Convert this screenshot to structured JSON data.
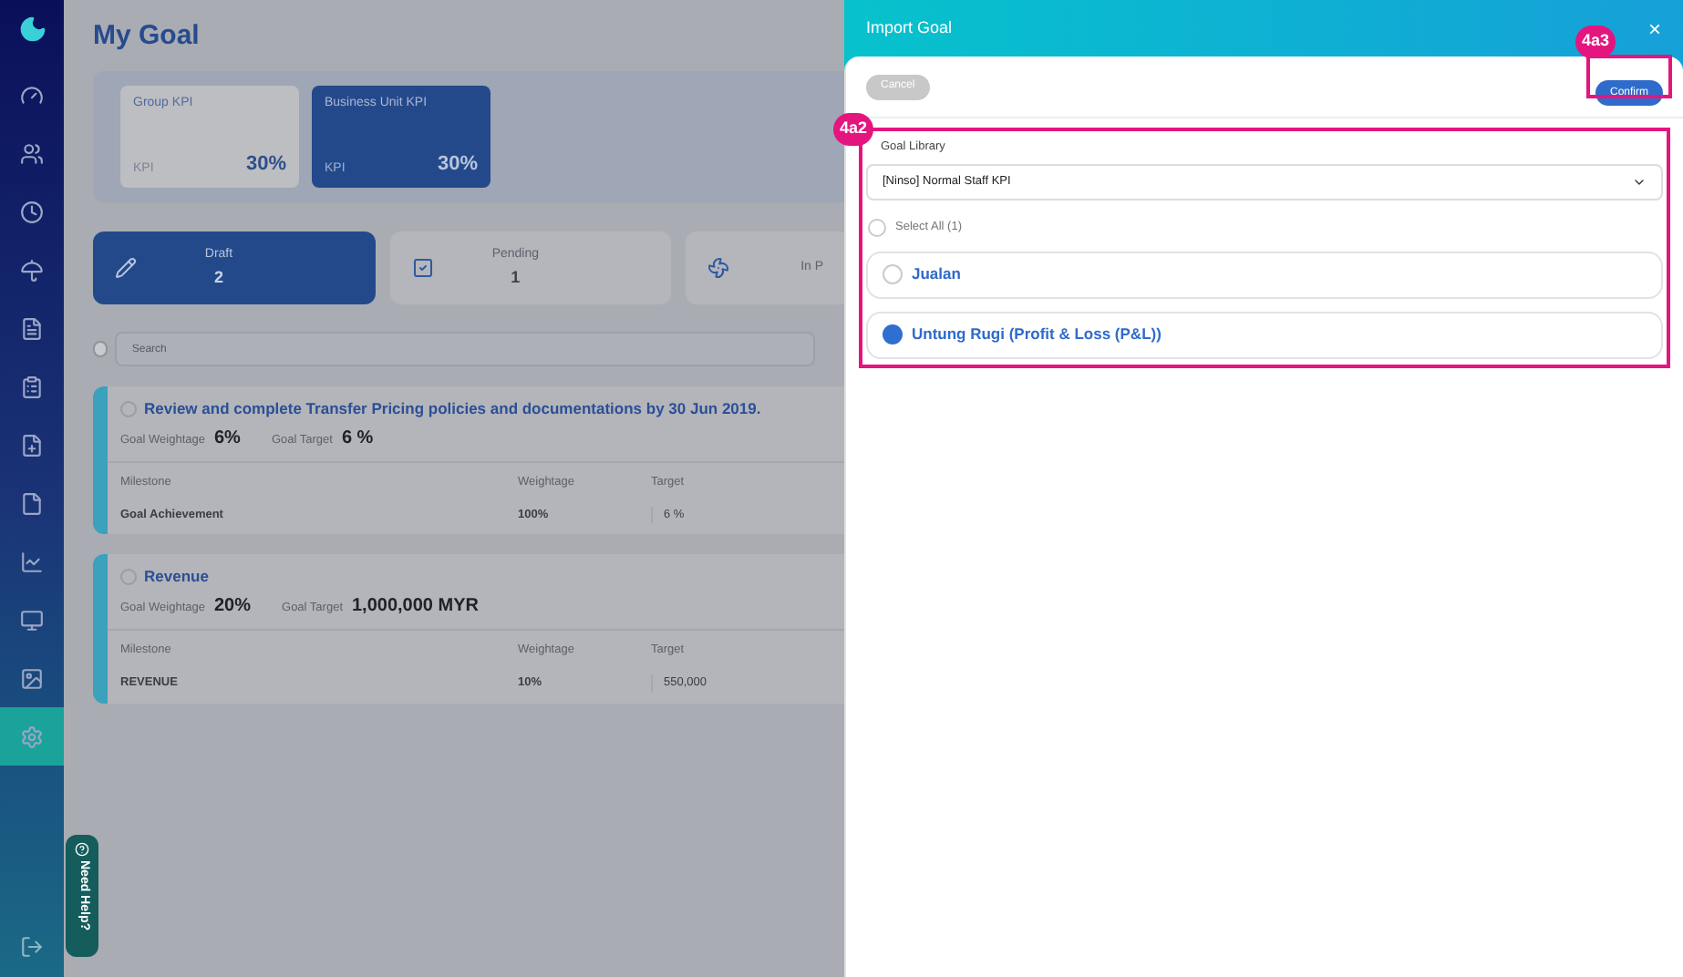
{
  "sidebar": {
    "items": [
      {
        "selected": false
      },
      {
        "selected": false
      },
      {
        "selected": false
      },
      {
        "selected": false
      },
      {
        "selected": false
      },
      {
        "selected": false
      },
      {
        "selected": false
      },
      {
        "selected": false
      },
      {
        "selected": false
      },
      {
        "selected": false
      },
      {
        "selected": false
      },
      {
        "selected": true
      }
    ],
    "help": "Need Help?"
  },
  "page": {
    "title": "My Goal"
  },
  "kpi_cards": [
    {
      "title": "Group KPI",
      "label": "KPI",
      "value": "30%",
      "selected": false
    },
    {
      "title": "Business Unit KPI",
      "label": "KPI",
      "value": "30%",
      "selected": true
    }
  ],
  "status_cards": [
    {
      "kind": "draft",
      "label": "Draft",
      "count": "2",
      "selected": true
    },
    {
      "kind": "pending",
      "label": "Pending",
      "count": "1",
      "selected": false
    },
    {
      "kind": "progress",
      "label": "In P",
      "selected": false
    }
  ],
  "search": {
    "placeholder": "Search",
    "checked": false
  },
  "goals": [
    {
      "title": "Review and complete Transfer Pricing policies and documentations by 30 Jun 2019.",
      "checked": false,
      "weightage_label": "Goal Weightage",
      "weightage": "6%",
      "target_label": "Goal Target",
      "target": "6 %",
      "columns": [
        "Milestone",
        "Weightage",
        "Target"
      ],
      "row": [
        "Goal Achievement",
        "100%",
        "6 %"
      ]
    },
    {
      "title": "Revenue",
      "checked": false,
      "weightage_label": "Goal Weightage",
      "weightage": "20%",
      "target_label": "Goal Target",
      "target": "1,000,000 MYR",
      "columns": [
        "Milestone",
        "Weightage",
        "Target"
      ],
      "row": [
        "REVENUE",
        "10%",
        "550,000"
      ]
    }
  ],
  "modal": {
    "title": "Import Goal",
    "close": "×",
    "cancel": {
      "label": "Cancel",
      "disabled": true
    },
    "confirm": {
      "label": "Confirm",
      "disabled": false
    },
    "library_label": "Goal Library",
    "library_value": "[Ninso] Normal Staff KPI",
    "select_all": {
      "label": "Select All (1)",
      "checked": false
    },
    "options": [
      {
        "label": "Jualan",
        "selected": false
      },
      {
        "label": "Untung Rugi (Profit & Loss (P&L))",
        "selected": true
      }
    ]
  },
  "callouts": {
    "confirm": "4a3",
    "library": "4a2"
  }
}
